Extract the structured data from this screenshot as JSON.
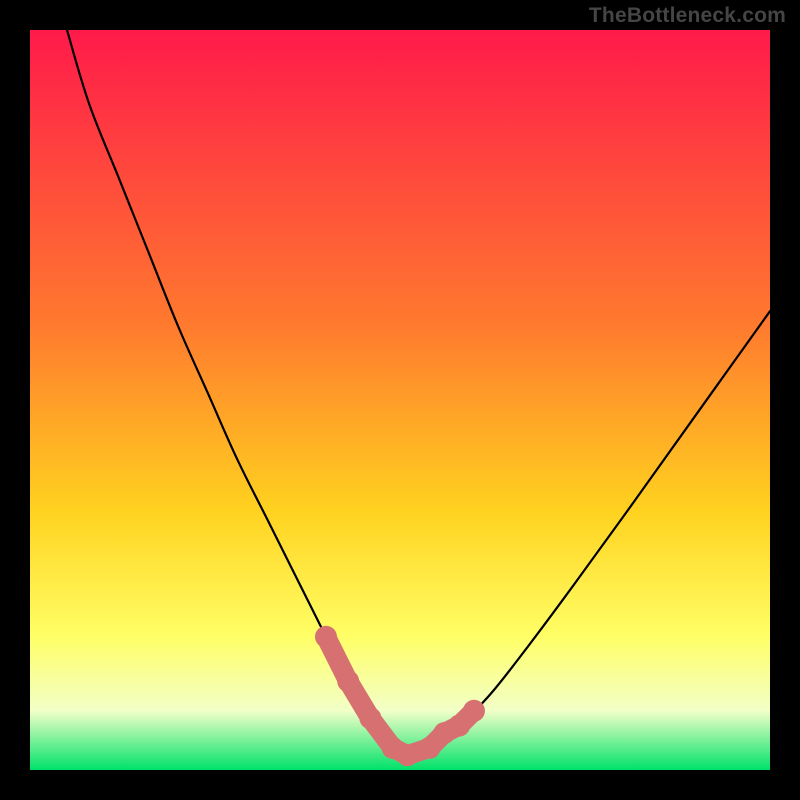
{
  "watermark": "TheBottleneck.com",
  "colors": {
    "frame_bg": "#000000",
    "grad_top": "#ff1a4a",
    "grad_mid1": "#ff6a2e",
    "grad_mid2": "#ffd21f",
    "grad_mid3": "#ffff55",
    "grad_low": "#f6ffcf",
    "grad_bottom": "#00e26a",
    "curve": "#000000",
    "marker": "#d77171"
  },
  "chart_data": {
    "type": "line",
    "title": "",
    "xlabel": "",
    "ylabel": "",
    "xlim": [
      0,
      100
    ],
    "ylim": [
      0,
      100
    ],
    "series": [
      {
        "name": "bottleneck-curve",
        "x": [
          5,
          8,
          12,
          16,
          20,
          24,
          28,
          32,
          36,
          40,
          43,
          46,
          49,
          51,
          54,
          58,
          62,
          66,
          72,
          80,
          90,
          100
        ],
        "y": [
          100,
          90,
          80,
          70,
          60,
          51,
          42,
          34,
          26,
          18,
          12,
          7,
          3,
          2,
          3,
          6,
          10,
          15,
          23,
          34,
          48,
          62
        ]
      }
    ],
    "markers": {
      "name": "highlight-valley",
      "x": [
        40,
        43,
        46,
        49,
        51,
        54,
        56,
        58,
        60
      ],
      "y": [
        18,
        12,
        7,
        3,
        2,
        3,
        5,
        6,
        8
      ]
    },
    "gradient_bands": [
      {
        "y": 100,
        "color": "#ff1a4a"
      },
      {
        "y": 60,
        "color": "#ff7a2e"
      },
      {
        "y": 35,
        "color": "#ffd21f"
      },
      {
        "y": 18,
        "color": "#ffff66"
      },
      {
        "y": 8,
        "color": "#f2ffc8"
      },
      {
        "y": 0,
        "color": "#00e26a"
      }
    ]
  }
}
